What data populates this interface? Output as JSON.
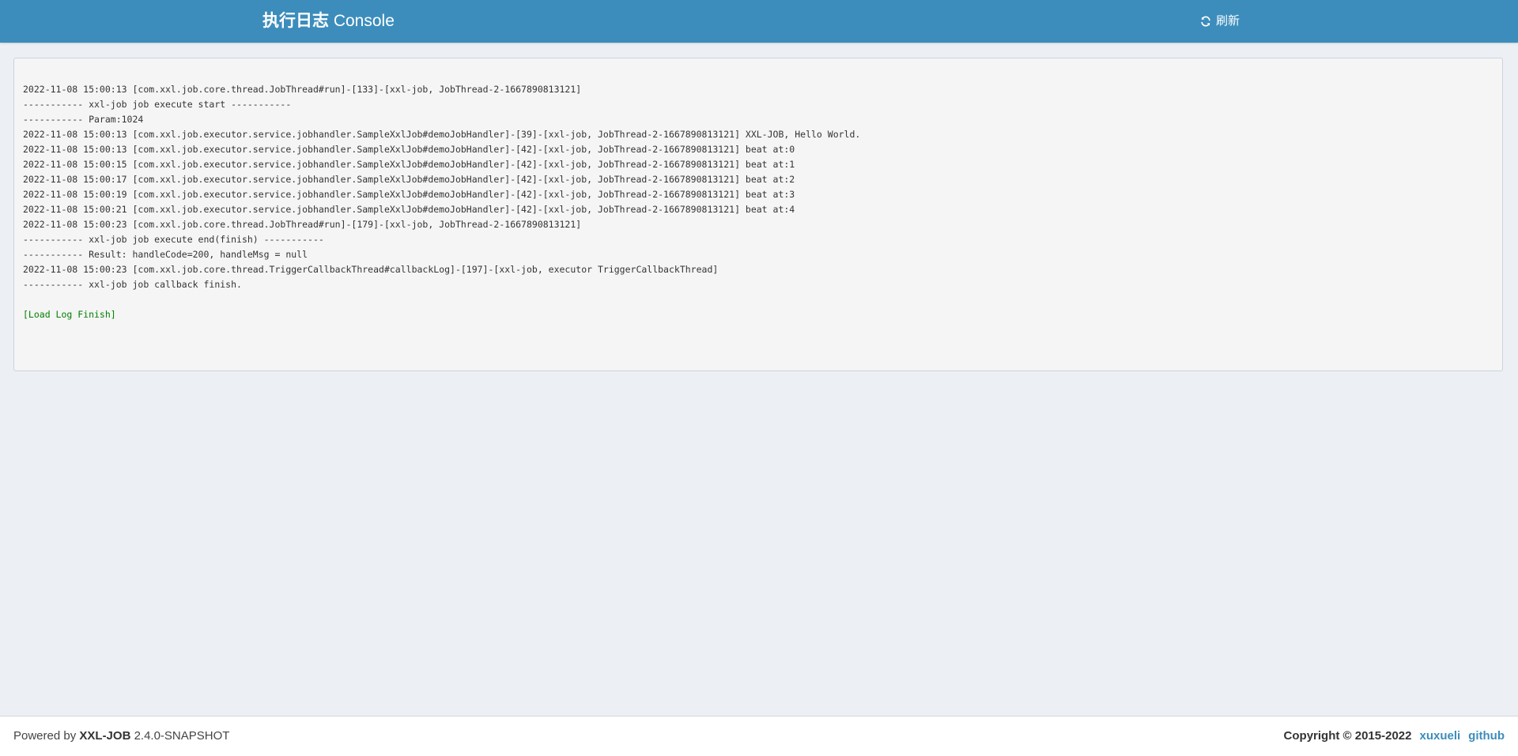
{
  "header": {
    "title_bold": "执行日志",
    "title_rest": " Console",
    "refresh_label": "刷新",
    "bg_color": "#3c8dbc"
  },
  "console": {
    "lines": [
      "2022-11-08 15:00:13 [com.xxl.job.core.thread.JobThread#run]-[133]-[xxl-job, JobThread-2-1667890813121]",
      "----------- xxl-job job execute start -----------",
      "----------- Param:1024",
      "2022-11-08 15:00:13 [com.xxl.job.executor.service.jobhandler.SampleXxlJob#demoJobHandler]-[39]-[xxl-job, JobThread-2-1667890813121] XXL-JOB, Hello World.",
      "2022-11-08 15:00:13 [com.xxl.job.executor.service.jobhandler.SampleXxlJob#demoJobHandler]-[42]-[xxl-job, JobThread-2-1667890813121] beat at:0",
      "2022-11-08 15:00:15 [com.xxl.job.executor.service.jobhandler.SampleXxlJob#demoJobHandler]-[42]-[xxl-job, JobThread-2-1667890813121] beat at:1",
      "2022-11-08 15:00:17 [com.xxl.job.executor.service.jobhandler.SampleXxlJob#demoJobHandler]-[42]-[xxl-job, JobThread-2-1667890813121] beat at:2",
      "2022-11-08 15:00:19 [com.xxl.job.executor.service.jobhandler.SampleXxlJob#demoJobHandler]-[42]-[xxl-job, JobThread-2-1667890813121] beat at:3",
      "2022-11-08 15:00:21 [com.xxl.job.executor.service.jobhandler.SampleXxlJob#demoJobHandler]-[42]-[xxl-job, JobThread-2-1667890813121] beat at:4",
      "2022-11-08 15:00:23 [com.xxl.job.core.thread.JobThread#run]-[179]-[xxl-job, JobThread-2-1667890813121]",
      "----------- xxl-job job execute end(finish) -----------",
      "----------- Result: handleCode=200, handleMsg = null",
      "2022-11-08 15:00:23 [com.xxl.job.core.thread.TriggerCallbackThread#callbackLog]-[197]-[xxl-job, executor TriggerCallbackThread]",
      "----------- xxl-job job callback finish."
    ],
    "finish_text": "[Load Log Finish]",
    "finish_color": "#008000"
  },
  "footer": {
    "powered_prefix": "Powered by ",
    "product": "XXL-JOB",
    "version": " 2.4.0-SNAPSHOT",
    "copyright": "Copyright © 2015-2022",
    "author_link": "xuxueli",
    "github_link": "github",
    "link_color": "#3c8dbc"
  },
  "icons": {
    "refresh": "refresh-icon"
  }
}
